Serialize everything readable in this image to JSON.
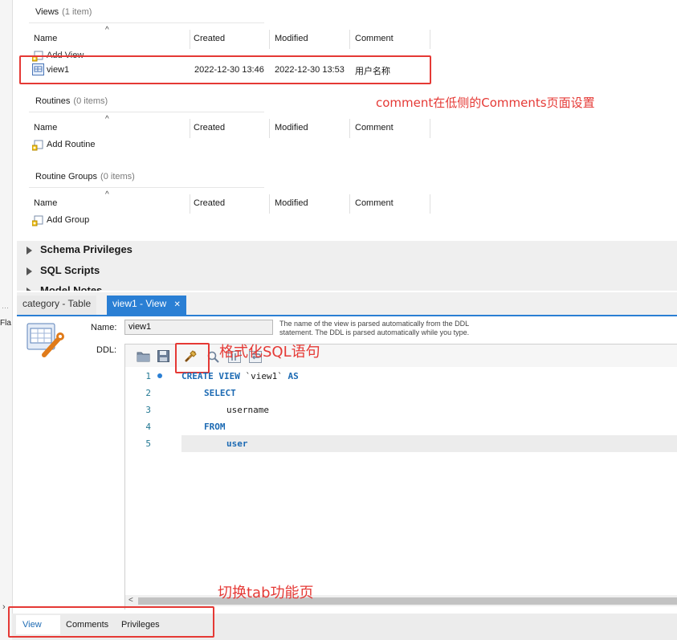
{
  "views": {
    "title": "Views",
    "count": "(1 item)",
    "columns": [
      "Name",
      "Created",
      "Modified",
      "Comment"
    ],
    "add_label": "Add View",
    "row": {
      "name": "view1",
      "created": "2022-12-30 13:46",
      "modified": "2022-12-30 13:53",
      "comment": "用户名称"
    }
  },
  "routines": {
    "title": "Routines",
    "count": "(0 items)",
    "columns": [
      "Name",
      "Created",
      "Modified",
      "Comment"
    ],
    "add_label": "Add Routine"
  },
  "routine_groups": {
    "title": "Routine Groups",
    "count": "(0 items)",
    "columns": [
      "Name",
      "Created",
      "Modified",
      "Comment"
    ],
    "add_label": "Add Group"
  },
  "collapsibles": [
    "Schema Privileges",
    "SQL Scripts",
    "Model Notes"
  ],
  "left_gutter_text": "Fla",
  "tabs": [
    {
      "label": "category - Table",
      "active": false
    },
    {
      "label": "view1 - View",
      "active": true,
      "close": "✕"
    }
  ],
  "editor": {
    "name_label": "Name:",
    "name_value": "view1",
    "hint_line1": "The name of the view is parsed automatically from the DDL",
    "hint_line2": "statement. The DDL is parsed automatically while you type.",
    "ddl_label": "DDL:",
    "code": [
      {
        "num": "1",
        "kw": "CREATE VIEW",
        "rest": " `view1` ",
        "kw2": "AS",
        "indent": 0
      },
      {
        "num": "2",
        "kw": "SELECT",
        "rest": "",
        "kw2": "",
        "indent": 1
      },
      {
        "num": "3",
        "kw": "",
        "rest": "username",
        "kw2": "",
        "indent": 2
      },
      {
        "num": "4",
        "kw": "FROM",
        "rest": "",
        "kw2": "",
        "indent": 1
      },
      {
        "num": "5",
        "kw": "",
        "rest": "user",
        "kw2": "",
        "indent": 2
      }
    ]
  },
  "bottom_tabs": [
    {
      "label": "View",
      "active": true
    },
    {
      "label": "Comments",
      "active": false
    },
    {
      "label": "Privileges",
      "active": false
    }
  ],
  "annotations": {
    "comment_note": "comment在低侧的Comments页面设置",
    "format_note": "格式化SQL语句",
    "tab_note": "切换tab功能页"
  },
  "colors": {
    "accent": "#2a7fd4",
    "annotation_red": "#e53935",
    "keyword": "#1c6ab3"
  }
}
